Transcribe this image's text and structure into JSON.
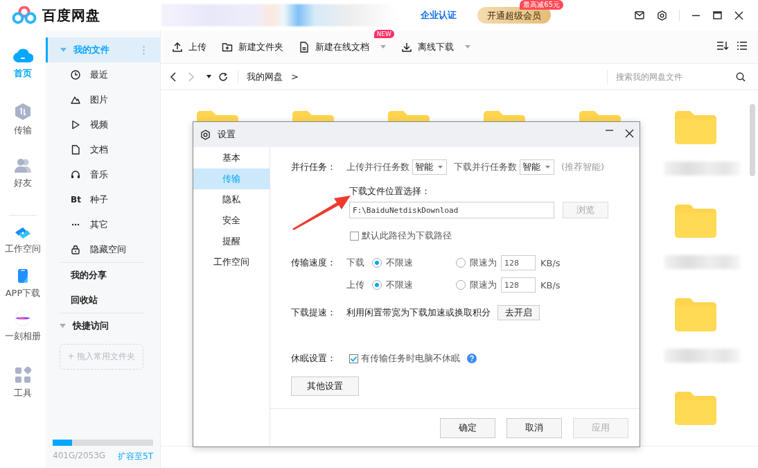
{
  "app": {
    "title": "百度网盘",
    "enterprise_link": "企业认证",
    "vip_button": "开通超级会员",
    "vip_badge": "最高减65元"
  },
  "nav_rail": [
    {
      "label": "首页",
      "selected": true
    },
    {
      "label": "传输",
      "selected": false
    },
    {
      "label": "好友",
      "selected": false
    },
    {
      "label": "工作空间",
      "selected": false
    },
    {
      "label": "APP下载",
      "selected": false
    },
    {
      "label": "一刻相册",
      "selected": false
    },
    {
      "label": "工具",
      "selected": false
    }
  ],
  "sidebar": {
    "my_files": {
      "label": "我的文件",
      "selected": true,
      "expanded": true,
      "children": [
        {
          "label": "最近"
        },
        {
          "label": "图片"
        },
        {
          "label": "视频"
        },
        {
          "label": "文档"
        },
        {
          "label": "音乐"
        },
        {
          "label": "种子",
          "icon_text": "Bt"
        },
        {
          "label": "其它"
        },
        {
          "label": "隐藏空间"
        }
      ]
    },
    "sections": [
      {
        "label": "我的分享"
      },
      {
        "label": "回收站"
      }
    ],
    "quick_access": {
      "label": "快捷访问",
      "expanded": true,
      "drop_hint": "+ 拖入常用文件夹"
    },
    "storage": {
      "level": 0.19,
      "usage": "401G/2053G",
      "expand_link": "扩容至5T"
    }
  },
  "toolbar": [
    {
      "label": "上传",
      "dropdown": false
    },
    {
      "label": "新建文件夹",
      "dropdown": false
    },
    {
      "label": "新建在线文档",
      "dropdown": true,
      "badge": "NEW"
    },
    {
      "label": "离线下载",
      "dropdown": true
    }
  ],
  "breadcrumb": {
    "path": "我的网盘",
    "separator": ">",
    "search_placeholder": "搜索我的网盘文件"
  },
  "dialog": {
    "title": "设置",
    "menu": [
      {
        "label": "基本",
        "selected": false
      },
      {
        "label": "传输",
        "selected": true
      },
      {
        "label": "隐私",
        "selected": false
      },
      {
        "label": "安全",
        "selected": false
      },
      {
        "label": "提醒",
        "selected": false
      },
      {
        "label": "工作空间",
        "selected": false
      }
    ],
    "parallel": {
      "label": "并行任务：",
      "upload_label": "上传并行任务数",
      "upload_value": "智能",
      "download_label": "下载并行任务数",
      "download_value": "智能",
      "hint": "(推荐智能)"
    },
    "location": {
      "label": "下载文件位置选择：",
      "path": "F:\\BaiduNetdiskDownload",
      "browse": "浏览",
      "browse_disabled": true,
      "default_checkbox": {
        "label": "默认此路径为下载路径",
        "checked": false
      }
    },
    "speed": {
      "label": "传输速度：",
      "rows": [
        {
          "direction": "下载",
          "unlimited": {
            "label": "不限速",
            "selected": true
          },
          "limit": {
            "label": "限速为",
            "selected": false,
            "value": "128",
            "unit": "KB/s"
          }
        },
        {
          "direction": "上传",
          "unlimited": {
            "label": "不限速",
            "selected": true
          },
          "limit": {
            "label": "限速为",
            "selected": false,
            "value": "128",
            "unit": "KB/s"
          }
        }
      ]
    },
    "boost": {
      "label": "下载提速：",
      "text": "利用闲置带宽为下载加速或换取积分",
      "button": "去开启"
    },
    "sleep": {
      "label": "休眠设置：",
      "checkbox": {
        "label": "有传输任务时电脑不休眠",
        "checked": true
      }
    },
    "other_button": "其他设置",
    "footer_buttons": [
      {
        "label": "确定",
        "disabled": false
      },
      {
        "label": "取消",
        "disabled": false
      },
      {
        "label": "应用",
        "disabled": true
      }
    ]
  }
}
